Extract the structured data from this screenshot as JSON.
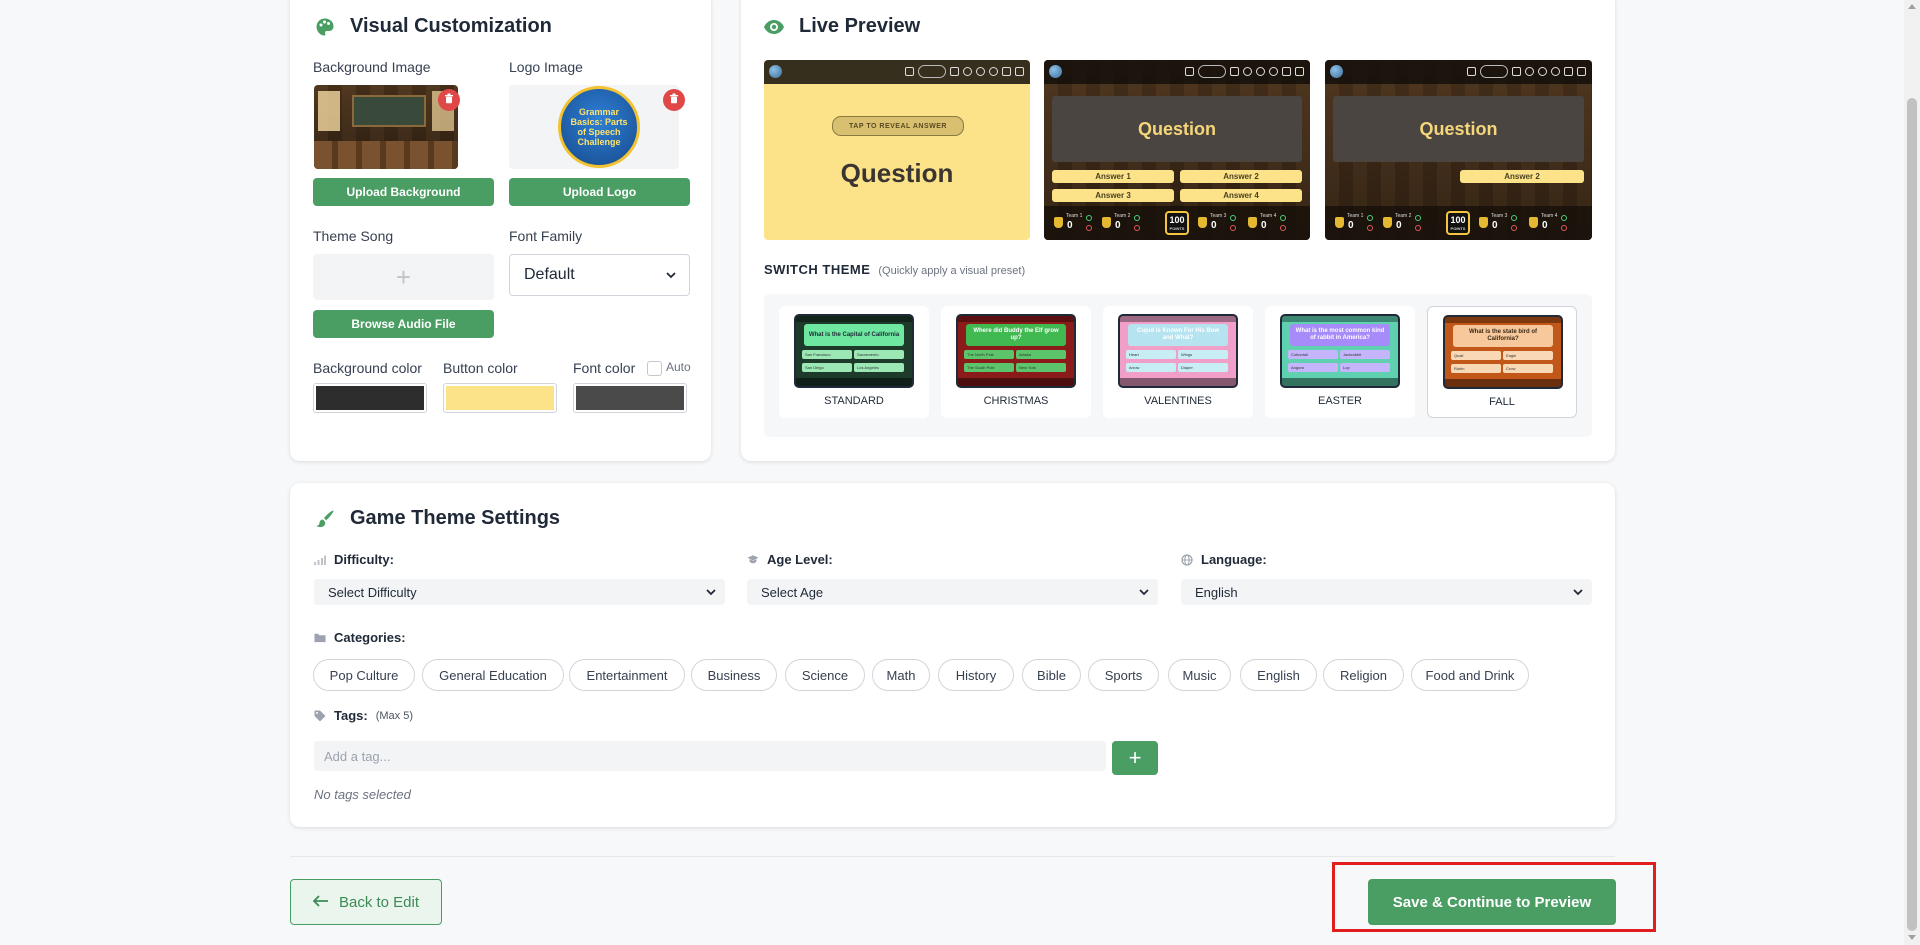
{
  "visual": {
    "title": "Visual Customization",
    "background_image_label": "Background Image",
    "logo_image_label": "Logo Image",
    "logo_text": "Grammar Basics: Parts of Speech Challenge",
    "upload_background": "Upload Background",
    "upload_logo": "Upload Logo",
    "theme_song_label": "Theme Song",
    "browse_audio": "Browse Audio File",
    "font_family_label": "Font Family",
    "font_family_value": "Default",
    "bg_color_label": "Background color",
    "button_color_label": "Button color",
    "font_color_label": "Font color",
    "auto_label": "Auto",
    "colors": {
      "background": "#2d2d2d",
      "button": "#fce38a",
      "font": "#4a4a4a"
    }
  },
  "preview": {
    "title": "Live Preview",
    "tap_reveal": "TAP TO REVEAL ANSWER",
    "question": "Question",
    "answers": [
      "Answer 1",
      "Answer 2",
      "Answer 3",
      "Answer 4"
    ],
    "answer_revealed": "Answer 2",
    "teams": [
      "Team 1",
      "Team 2",
      "Team 3",
      "Team 4"
    ],
    "score": "0",
    "timer": "100",
    "timer_sub": "POINTS"
  },
  "themes": {
    "title": "SWITCH THEME",
    "subtitle": "(Quickly apply a visual preset)",
    "items": [
      {
        "name": "STANDARD",
        "question": "What is the Capital of California",
        "answers": [
          "San Francisco",
          "Sacramento",
          "San Diego",
          "Los Angeles"
        ],
        "bg": "#1e3a2a",
        "q_bg": "#6ee7a0",
        "a_bg": "#9be8b5",
        "q_color": "#1f2937"
      },
      {
        "name": "CHRISTMAS",
        "question": "Where did Buddy the Elf grow up?",
        "answers": [
          "The North Pole",
          "Alaska",
          "The South Pole",
          "New York"
        ],
        "bg": "#8b1a1a",
        "q_bg": "#3fb950",
        "a_bg": "#5cc46a",
        "q_color": "#ffffff"
      },
      {
        "name": "VALENTINES",
        "question": "Cupid is Known For His Bow and What?",
        "answers": [
          "Heart",
          "Wings",
          "Arrow",
          "Diaper"
        ],
        "bg": "#f0a0c8",
        "q_bg": "#b6e3f0",
        "a_bg": "#c8eef5",
        "q_color": "#ffffff"
      },
      {
        "name": "EASTER",
        "question": "What is the most common kind of rabbit in America?",
        "answers": [
          "Cottontail",
          "Jackrabbit",
          "Angora",
          "Lop"
        ],
        "bg": "#5fd1b0",
        "q_bg": "#a78bfa",
        "a_bg": "#c4b5fd",
        "q_color": "#ffffff"
      },
      {
        "name": "FALL",
        "question": "What is the state bird of California?",
        "answers": [
          "Quail",
          "Eagle",
          "Robin",
          "Crow"
        ],
        "bg": "#c2571a",
        "q_bg": "#f6c89b",
        "a_bg": "#f9d9b5",
        "q_color": "#3b2815"
      }
    ]
  },
  "game": {
    "title": "Game Theme Settings",
    "difficulty_label": "Difficulty:",
    "difficulty_value": "Select Difficulty",
    "age_label": "Age Level:",
    "age_value": "Select Age",
    "language_label": "Language:",
    "language_value": "English",
    "categories_label": "Categories:",
    "categories": [
      "Pop Culture",
      "General Education",
      "Entertainment",
      "Business",
      "Science",
      "Math",
      "History",
      "Bible",
      "Sports",
      "Music",
      "English",
      "Religion",
      "Food and Drink"
    ],
    "tags_label": "Tags:",
    "tags_max": "(Max 5)",
    "tag_placeholder": "Add a tag...",
    "no_tags": "No tags selected"
  },
  "footer": {
    "back": "Back to Edit",
    "save": "Save & Continue to Preview"
  },
  "accent": "#4a9d63"
}
